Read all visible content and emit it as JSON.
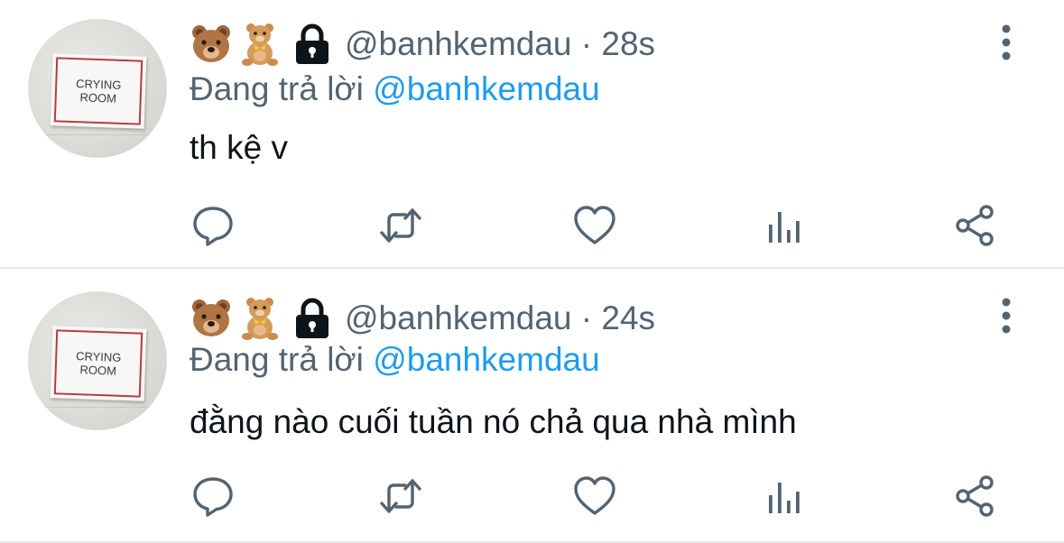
{
  "colors": {
    "text": "#0f1419",
    "secondary": "#536471",
    "accent": "#1d9bf0",
    "divider": "#e6e8ea",
    "sign_border": "#b83b3b"
  },
  "tweets": [
    {
      "avatar_sign_line1": "CRYING",
      "avatar_sign_line2": "ROOM",
      "name_icons": [
        "bear-face-icon",
        "teddy-bear-icon",
        "lock-icon"
      ],
      "handle_meta": "@banhkemdau · 28s",
      "reply_prefix": "Đang trả lời ",
      "reply_mention": "@banhkemdau",
      "text": "th kệ v",
      "action_icons": [
        "reply-icon",
        "retweet-icon",
        "like-icon",
        "stats-icon",
        "share-icon"
      ]
    },
    {
      "avatar_sign_line1": "CRYING",
      "avatar_sign_line2": "ROOM",
      "name_icons": [
        "bear-face-icon",
        "teddy-bear-icon",
        "lock-icon"
      ],
      "handle_meta": "@banhkemdau · 24s",
      "reply_prefix": "Đang trả lời ",
      "reply_mention": "@banhkemdau",
      "text": "đằng nào cuối tuần nó chả qua nhà mình",
      "action_icons": [
        "reply-icon",
        "retweet-icon",
        "like-icon",
        "stats-icon",
        "share-icon"
      ]
    }
  ]
}
